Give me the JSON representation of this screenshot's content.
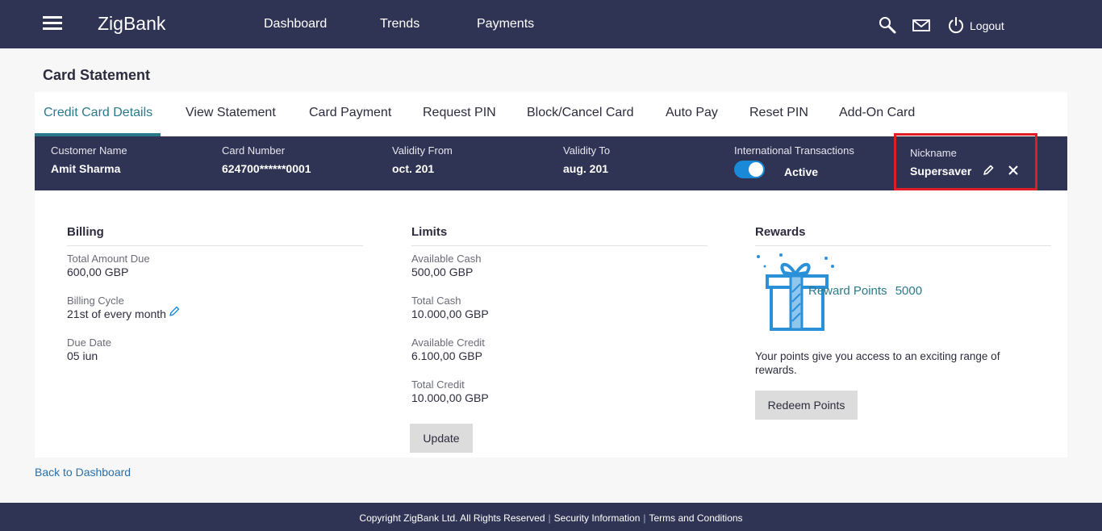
{
  "header": {
    "brand": "ZigBank",
    "nav": [
      "Dashboard",
      "Trends",
      "Payments"
    ],
    "logout_label": "Logout",
    "icons": [
      "menu-icon",
      "search-icon",
      "mail-icon",
      "power-icon"
    ]
  },
  "page": {
    "title": "Card Statement"
  },
  "tabs": [
    {
      "label": "Credit Card Details",
      "active": true
    },
    {
      "label": "View Statement"
    },
    {
      "label": "Card Payment"
    },
    {
      "label": "Request PIN"
    },
    {
      "label": "Block/Cancel Card"
    },
    {
      "label": "Auto Pay"
    },
    {
      "label": "Reset PIN"
    },
    {
      "label": "Add-On Card"
    }
  ],
  "card": {
    "customer_name_label": "Customer Name",
    "customer_name": "Amit Sharma",
    "card_number_label": "Card Number",
    "card_number": "624700******0001",
    "validity_from_label": "Validity From",
    "validity_from": "oct. 201",
    "validity_to_label": "Validity To",
    "validity_to": "aug. 201",
    "intl_label": "International Transactions",
    "intl_status": "Active",
    "intl_enabled": true,
    "nickname_label": "Nickname",
    "nickname": "Supersaver"
  },
  "billing": {
    "heading": "Billing",
    "total_amount_due_label": "Total Amount Due",
    "total_amount_due": "600,00 GBP",
    "billing_cycle_label": "Billing Cycle",
    "billing_cycle": "21st of every month",
    "due_date_label": "Due Date",
    "due_date": "05 iun"
  },
  "limits": {
    "heading": "Limits",
    "available_cash_label": "Available Cash",
    "available_cash": "500,00 GBP",
    "total_cash_label": "Total Cash",
    "total_cash": "10.000,00 GBP",
    "available_credit_label": "Available Credit",
    "available_credit": "6.100,00 GBP",
    "total_credit_label": "Total Credit",
    "total_credit": "10.000,00 GBP",
    "update_label": "Update"
  },
  "rewards": {
    "heading": "Rewards",
    "points_label": "Reward Points",
    "points": "5000",
    "description": "Your points give you access to an exciting range of rewards.",
    "redeem_label": "Redeem Points"
  },
  "back_link": "Back to Dashboard",
  "footer": {
    "copyright": "Copyright ZigBank Ltd. All Rights Reserved",
    "security": "Security Information",
    "terms": "Terms and Conditions"
  },
  "colors": {
    "navy": "#2f3455",
    "accent": "#2a7a8c",
    "toggle": "#1a8ad8",
    "highlight": "#e01c24"
  }
}
